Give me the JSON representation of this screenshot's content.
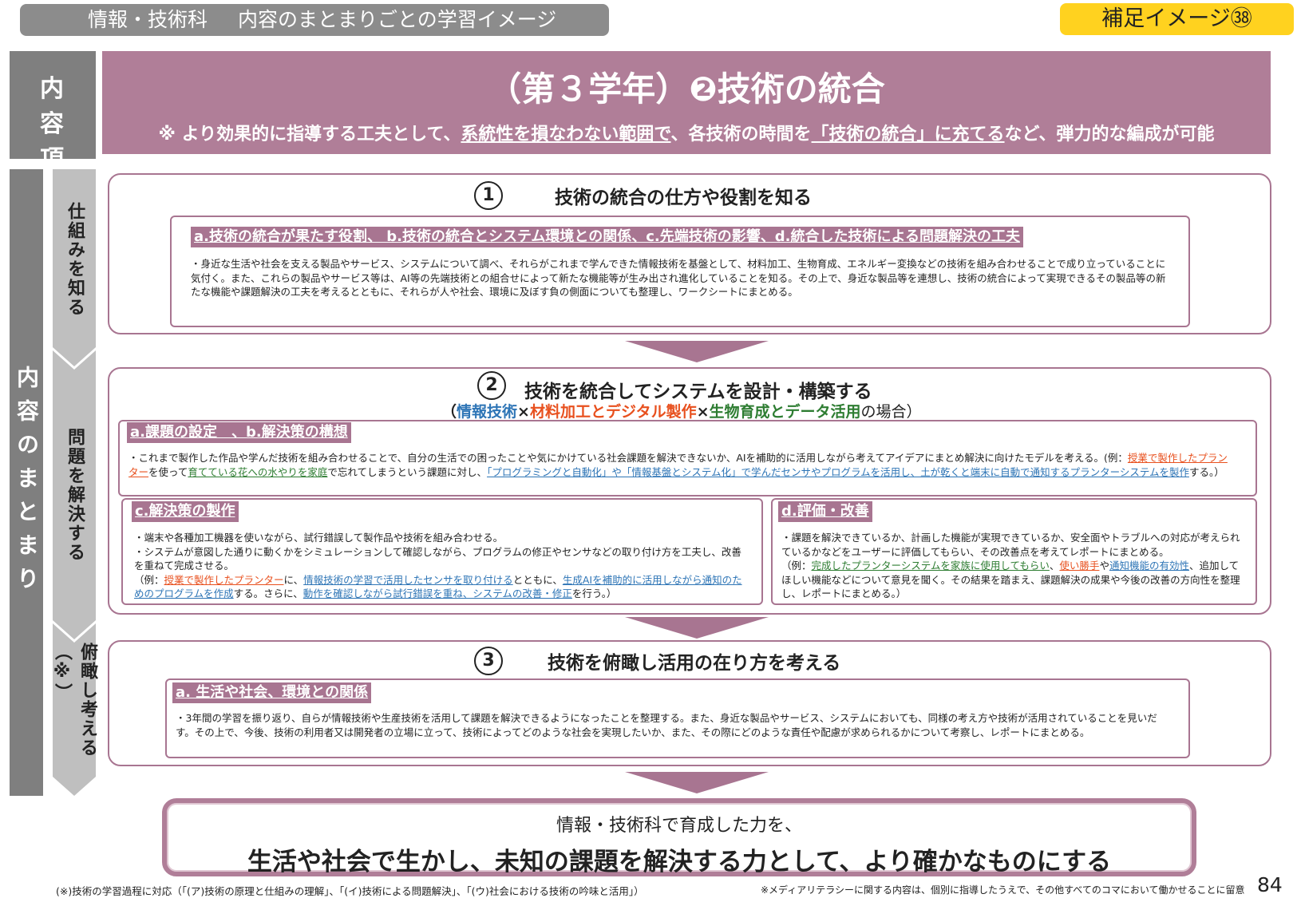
{
  "header_bar": {
    "subject": "情報・技術科",
    "title": "内容のまとまりごとの学習イメージ"
  },
  "badge": "補足イメージ㊳",
  "label_content_item": [
    "内 容",
    "項 目"
  ],
  "main": {
    "title": "（第３学年）❷技術の統合",
    "note_pre": "※ より効果的に指導する工夫として、",
    "note_u1": "系統性を損なわない範囲で",
    "note_mid": "、各技術の時間を",
    "note_u2": "「技術の統合」に充てる",
    "note_post": "など、弾力的な編成が可能"
  },
  "side_label": "内容のまとまり",
  "steps": [
    "仕組みを知る",
    "問題を解決する",
    "俯瞰し考える（※）"
  ],
  "panel1": {
    "num": "1",
    "title": "技術の統合の仕方や役割を知る",
    "heading": "a.技術の統合が果たす役割、 b.技術の統合とシステム環境との関係、c.先端技術の影響、d.統合した技術による問題解決の工夫",
    "body": "・身近な生活や社会を支える製品やサービス、システムについて調べ、それらがこれまで学んできた情報技術を基盤として、材料加工、生物育成、エネルギー変換などの技術を組み合わせることで成り立っていることに気付く。また、これらの製品やサービス等は、AI等の先端技術との組合せによって新たな機能等が生み出され進化していることを知る。その上で、身近な製品等を連想し、技術の統合によって実現できるその製品等の新たな機能や課題解決の工夫を考えるとともに、それらが人や社会、環境に及ぼす負の側面についても整理し、ワークシートにまとめる。"
  },
  "panel2": {
    "num": "2",
    "title": "技術を統合してシステムを設計・構築する",
    "sub": {
      "open": "（",
      "t1": "情報技術",
      "x1": "×",
      "t2": "材料加工とデジタル製作",
      "x2": "×",
      "t3": "生物育成とデータ活用",
      "close": "の場合）"
    },
    "ab": {
      "heading": "a.課題の設定　、b.解決策の構想",
      "p1": "・これまで製作した作品や学んだ技術を組み合わせることで、自分の生活での困ったことや気にかけている社会課題を解決できないか、AIを補助的に活用しながら考えてアイデアにまとめ解決に向けたモデルを考える。(例：",
      "h1": "授業で製作したプランター",
      "p2": "を使って",
      "h2": "育てている花への水やりを家庭",
      "p3": "で忘れてしまうという課題に対し、",
      "h3": "「プログラミングと自動化」や「情報基盤とシステム化」で学んだセンサやプログラムを活用し、土が乾くと端末に自動で通知するプランターシステムを製作",
      "p4": "する。）"
    },
    "c": {
      "heading": "c.解決策の製作",
      "l1": "・端末や各種加工機器を使いながら、試行錯誤して製作品や技術を組み合わせる。",
      "l2": "・システムが意図した通りに動くかをシミュレーションして確認しながら、プログラムの修正やセンサなどの取り付け方を工夫し、改善を重ねて完成させる。",
      "p1": "（例：",
      "h1": "授業で製作したプランター",
      "p2": "に、",
      "h2": "情報技術の学習で活用したセンサを取り付ける",
      "p3": "とともに、",
      "h3": "生成AIを補助的に活用しながら通知のためのプログラムを作成",
      "p4": "する。さらに、",
      "h4": "動作を確認しながら試行錯誤を重ね、システムの改善・修正",
      "p5": "を行う。）"
    },
    "d": {
      "heading": "d.評価・改善",
      "l1": "・課題を解決できているか、計画した機能が実現できているか、安全面やトラブルへの対応が考えられているかなどをユーザーに評価してもらい、その改善点を考えてレポートにまとめる。",
      "p1": "（例：",
      "h1": "完成したプランターシステムを家族に使用してもらい",
      "p2": "、",
      "h2": "使い勝手",
      "p3": "や",
      "h3": "通知機能の有効性",
      "p4": "、追加してほしい機能などについて意見を聞く。その結果を踏まえ、課題解決の成果や今後の改善の方向性を整理し、レポートにまとめる。）"
    }
  },
  "panel3": {
    "num": "3",
    "title": "技術を俯瞰し活用の在り方を考える",
    "heading": "a. 生活や社会、環境との関係",
    "body": "・3年間の学習を振り返り、自らが情報技術や生産技術を活用して課題を解決できるようになったことを整理する。また、身近な製品やサービス、システムにおいても、同様の考え方や技術が活用されていることを見いだす。その上で、今後、技術の利用者又は開発者の立場に立って、技術によってどのような社会を実現したいか、また、その際にどのような責任や配慮が求められるかについて考察し、レポートにまとめる。"
  },
  "final": {
    "line1": "情報・技術科で育成した力を、",
    "line2": "生活や社会で生かし、未知の課題を解決する力として、より確かなものにする"
  },
  "footer": {
    "left": "(※)技術の学習過程に対応（「(ア)技術の原理と仕組みの理解」、「(イ)技術による問題解決」、「(ウ)社会における技術の吟味と活用」）",
    "right": "※メディアリテラシーに関する内容は、個別に指導したうえで、その他すべてのコマにおいて働かせることに留意",
    "page": "84"
  },
  "colors": {
    "accent": "#b07e98",
    "border": "#a87591",
    "gray": "#7f7f7f",
    "step": "#bfbfbf",
    "badge": "#ffd21f",
    "blue": "#2e75b6",
    "orange": "#e8501e",
    "green": "#2e7d32"
  }
}
